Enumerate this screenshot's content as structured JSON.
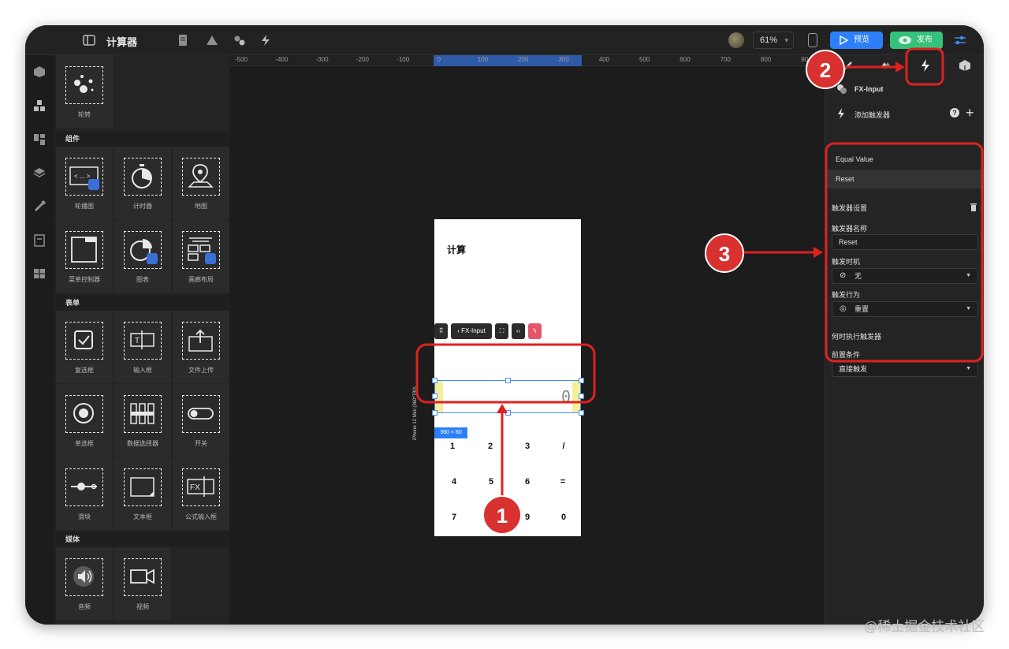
{
  "header": {
    "title": "计算器",
    "zoom": "61%",
    "preview_label": "预览",
    "publish_label": "发布"
  },
  "components": {
    "top_item": "轮转",
    "sections": [
      {
        "title": "组件",
        "items": [
          "轮播图",
          "计时器",
          "地图",
          "菜单控制器",
          "图表",
          "画廊布局"
        ]
      },
      {
        "title": "表单",
        "items": [
          "复选框",
          "输入框",
          "文件上传",
          "单选框",
          "数据选择器",
          "开关",
          "滑块",
          "文本框",
          "公式输入框"
        ]
      },
      {
        "title": "媒体",
        "items": [
          "音频",
          "视频"
        ]
      }
    ]
  },
  "ruler": {
    "ticks": [
      "-500",
      "-400",
      "-300",
      "-200",
      "-100",
      "0",
      "100",
      "200",
      "300",
      "400",
      "500",
      "600",
      "700",
      "800",
      "90"
    ]
  },
  "phone": {
    "title": "计算",
    "toolbar_label": "FX-Input",
    "input_value": "0",
    "size_tag": "360 × 80",
    "device_label": "iPhone 12 Mini (360*780)",
    "keys": [
      [
        "+",
        "-",
        "*"
      ],
      [
        "1",
        "2",
        "3",
        "/"
      ],
      [
        "4",
        "5",
        "6",
        "="
      ],
      [
        "7",
        "",
        "9",
        "0"
      ]
    ]
  },
  "inspector": {
    "component": "FX-Input",
    "add_trigger": "添加触发器",
    "trigger_group": "Equal Value",
    "selected_trigger": "Reset",
    "settings_title": "触发器设置",
    "name_label": "触发器名称",
    "name_value": "Reset",
    "timing_label": "触发时机",
    "timing_value": "无",
    "action_label": "触发行为",
    "action_value": "重置",
    "when_title": "何时执行触发器",
    "precondition_label": "前置条件",
    "precondition_value": "直接触发"
  },
  "annotations": {
    "badges": [
      "1",
      "2",
      "3"
    ]
  },
  "watermark": "@稀土掘金技术社区",
  "colors": {
    "accent_blue": "#2d7ff9",
    "publish_green": "#34c27a",
    "annotation_red": "#d93030"
  }
}
